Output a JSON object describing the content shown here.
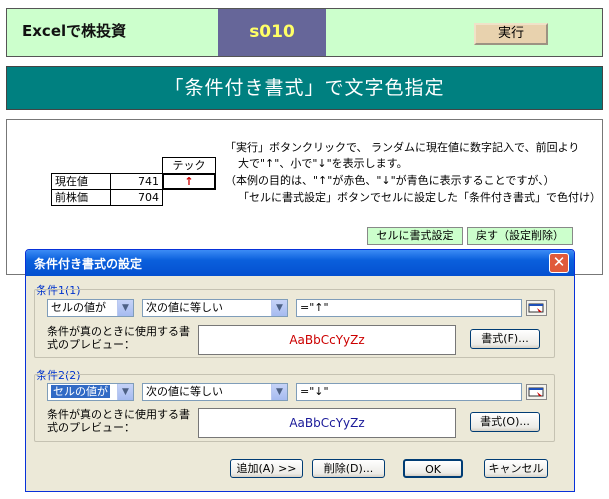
{
  "banner": {
    "app_title": "Excelで株投資",
    "sheet_id": "s010",
    "run_label": "実行"
  },
  "heading": "「条件付き書式」で文字色指定",
  "description": [
    "「実行」ボタンクリックで、 ランダムに現在値に数字記入で、前回より",
    "大で\"↑\"、小で\"↓\"を表示します。",
    "（本例の目的は、\"↑\"が赤色、\"↓\"が青色に表示することですが、）",
    "「セルに書式設定」ボタンでセルに設定した「条件付き書式」で色付け）"
  ],
  "table": {
    "tech_header": "テック",
    "rows": [
      {
        "label": "現在値",
        "value": "741",
        "mark": "↑"
      },
      {
        "label": "前株価",
        "value": "704",
        "mark": ""
      }
    ]
  },
  "buttons": {
    "apply_format": "セルに書式設定",
    "undo": "戻す（設定削除）"
  },
  "dialog": {
    "title": "条件付き書式の設定",
    "close_glyph": "✕",
    "conditions": [
      {
        "label": "条件1(1)",
        "type": "セルの値が",
        "operator": "次の値に等しい",
        "formula": "=\"↑\"",
        "preview_label": "条件が真のときに使用する書式のプレビュー：",
        "preview_text": "AaBbCcYyZz",
        "preview_color": "#cc0000",
        "format_button": "書式(F)..."
      },
      {
        "label": "条件2(2)",
        "type": "セルの値が",
        "operator": "次の値に等しい",
        "formula": "=\"↓\"",
        "preview_label": "条件が真のときに使用する書式のプレビュー：",
        "preview_text": "AaBbCcYyZz",
        "preview_color": "#1a1a99",
        "format_button": "書式(O)..."
      }
    ],
    "add_button": "追加(A) >>",
    "delete_button": "削除(D)...",
    "ok_button": "OK",
    "cancel_button": "キャンセル"
  },
  "colors": {
    "banner_bg": "#ccffcc",
    "heading_bg": "#008080",
    "sheet_id_bg": "#666699",
    "sheet_id_text": "#ffff66",
    "arrow_up": "#cc0000"
  }
}
